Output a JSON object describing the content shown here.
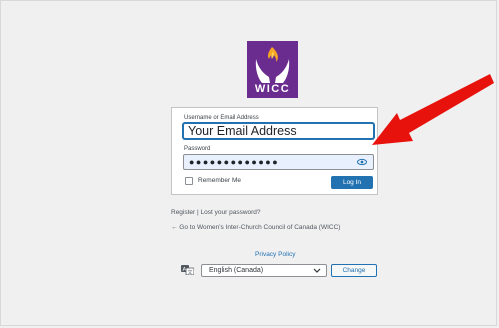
{
  "logo": {
    "text": "WICC",
    "icon": "wicc-logo-hands-flame"
  },
  "form": {
    "username_label": "Username or Email Address",
    "username_value": "Your Email Address",
    "password_label": "Password",
    "password_value": "●●●●●●●●●●●●●",
    "remember_label": "Remember Me",
    "remember_checked": false,
    "login_label": "Log In"
  },
  "links": {
    "register": "Register",
    "separator": "|",
    "lost_password": "Lost your password?",
    "back": "← Go to Women's Inter-Church Council of Canada (WICC)",
    "privacy": "Privacy Policy"
  },
  "language": {
    "selected": "English (Canada)",
    "change_label": "Change",
    "icon": "translation-icon"
  },
  "annotation": {
    "arrow_color": "#e8120c"
  },
  "colors": {
    "accent": "#2271b1",
    "brand": "#6a2c8e",
    "background": "#f0f0f1"
  }
}
